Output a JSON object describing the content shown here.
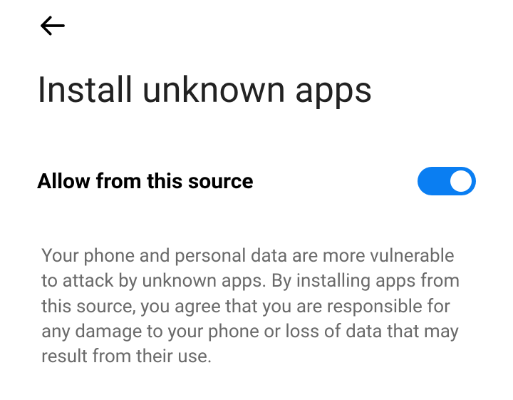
{
  "header": {
    "back_icon": "arrow-left"
  },
  "page": {
    "title": "Install unknown apps"
  },
  "setting": {
    "label": "Allow from this source",
    "enabled": true
  },
  "description": {
    "text": "Your phone and personal data are more vulnerable to attack by unknown apps. By installing apps from this source, you agree that you are responsible for any damage to your phone or loss of data that may result from their use."
  },
  "colors": {
    "accent": "#0a7ef2",
    "text_primary": "#000000",
    "text_secondary": "#6a6a6a",
    "title": "#222222"
  }
}
